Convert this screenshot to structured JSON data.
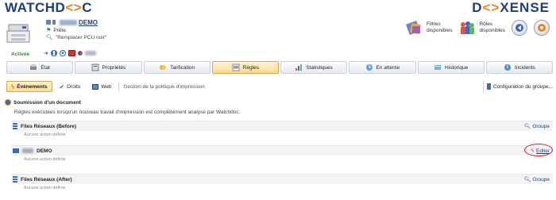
{
  "brand": {
    "left_a": "WATCHD",
    "left_b": "C",
    "right_a": "D",
    "right_b": "XENSE"
  },
  "device": {
    "name": "DEMO",
    "status": "Prête.",
    "replace_label": "\"Remplacer PCU noir\"",
    "activated_label": "Activée"
  },
  "toolbar": {
    "filters_label_1": "Filtres",
    "filters_label_2": "disponibles",
    "roles_label_1": "Rôles",
    "roles_label_2": "disponibles"
  },
  "tabs": [
    {
      "label": "État",
      "icon": "printer-icon"
    },
    {
      "label": "Propriétés",
      "icon": "properties-icon"
    },
    {
      "label": "Tarification",
      "icon": "pricing-icon"
    },
    {
      "label": "Règles",
      "icon": "rules-icon",
      "active": true
    },
    {
      "label": "Statistiques",
      "icon": "statistics-icon"
    },
    {
      "label": "En attente",
      "icon": "pending-icon"
    },
    {
      "label": "Historique",
      "icon": "history-icon"
    },
    {
      "label": "Incidents",
      "icon": "incidents-icon"
    }
  ],
  "subtabs": {
    "events": "Événements",
    "rights": "Droits",
    "web": "Web",
    "description": "Gestion de la politique d'impression",
    "group_config": "Configuration du groupe..."
  },
  "section": {
    "title": "Soumission d'un document",
    "description": "Règles exécutées lorsqu'un nouveau travail d'impression est complètement analysé par Watchdoc."
  },
  "rows": [
    {
      "title": "Files Réseaux (Before)",
      "sub": "Aucune action définie",
      "action": "Groupe"
    },
    {
      "title": "DEMO",
      "sub": "Aucune action définie",
      "action": "Editer"
    },
    {
      "title": "Files Réseaux (After)",
      "sub": "Aucune action définie",
      "action": "Groupe"
    }
  ],
  "colors": {
    "brand_blue": "#1f3e7c",
    "brand_orange": "#e8831f",
    "active_tab": "#ffd98c",
    "highlight_red": "#d21f1f"
  }
}
